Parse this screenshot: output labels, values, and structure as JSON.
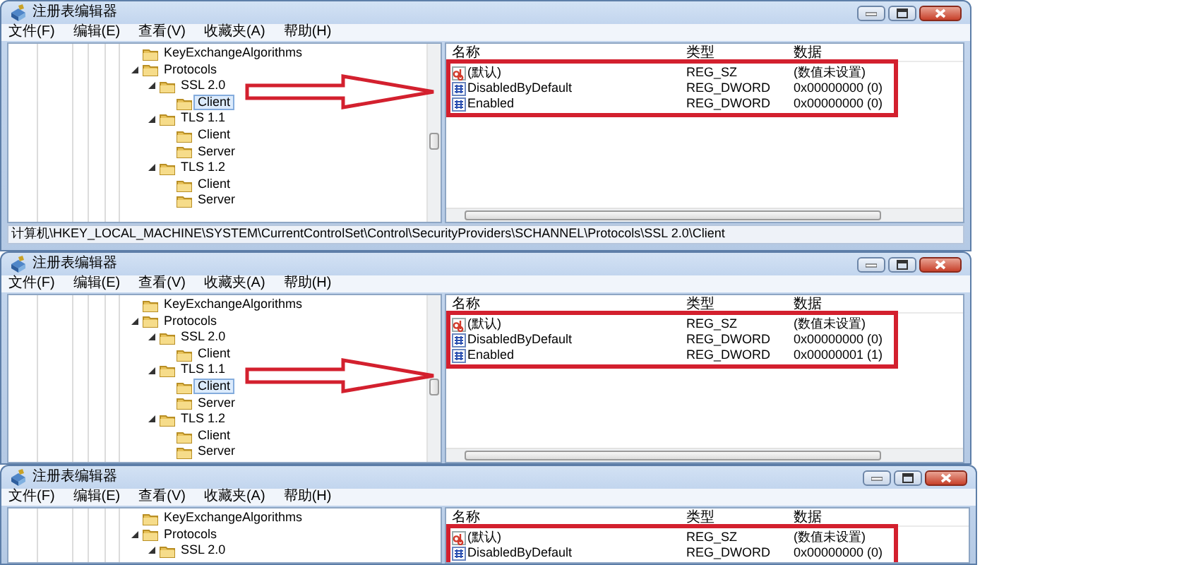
{
  "windows": [
    {
      "title": "注册表编辑器",
      "menu": [
        "文件(F)",
        "编辑(E)",
        "查看(V)",
        "收藏夹(A)",
        "帮助(H)"
      ],
      "tree": [
        {
          "label": "KeyExchangeAlgorithms",
          "selected": false
        },
        {
          "label": "Protocols",
          "selected": false,
          "expanded": true,
          "children": [
            {
              "label": "SSL 2.0",
              "selected": false,
              "expanded": true,
              "children": [
                {
                  "label": "Client",
                  "selected": true
                }
              ]
            },
            {
              "label": "TLS 1.1",
              "selected": false,
              "expanded": true,
              "children": [
                {
                  "label": "Client",
                  "selected": false
                },
                {
                  "label": "Server",
                  "selected": false
                }
              ]
            },
            {
              "label": "TLS 1.2",
              "selected": false,
              "expanded": true,
              "children": [
                {
                  "label": "Client",
                  "selected": false
                },
                {
                  "label": "Server",
                  "selected": false
                }
              ]
            }
          ]
        }
      ],
      "columns": [
        "名称",
        "类型",
        "数据"
      ],
      "rows": [
        {
          "kind": "string",
          "name": "(默认)",
          "type": "REG_SZ",
          "data": "(数值未设置)"
        },
        {
          "kind": "dword",
          "name": "DisabledByDefault",
          "type": "REG_DWORD",
          "data": "0x00000000 (0)"
        },
        {
          "kind": "dword",
          "name": "Enabled",
          "type": "REG_DWORD",
          "data": "0x00000000 (0)"
        }
      ],
      "status": "计算机\\HKEY_LOCAL_MACHINE\\SYSTEM\\CurrentControlSet\\Control\\SecurityProviders\\SCHANNEL\\Protocols\\SSL 2.0\\Client",
      "highlight": true,
      "arrow": true
    },
    {
      "title": "注册表编辑器",
      "menu": [
        "文件(F)",
        "编辑(E)",
        "查看(V)",
        "收藏夹(A)",
        "帮助(H)"
      ],
      "tree": [
        {
          "label": "KeyExchangeAlgorithms",
          "selected": false
        },
        {
          "label": "Protocols",
          "selected": false,
          "expanded": true,
          "children": [
            {
              "label": "SSL 2.0",
              "selected": false,
              "expanded": true,
              "children": [
                {
                  "label": "Client",
                  "selected": false
                }
              ]
            },
            {
              "label": "TLS 1.1",
              "selected": false,
              "expanded": true,
              "children": [
                {
                  "label": "Client",
                  "selected": true
                },
                {
                  "label": "Server",
                  "selected": false
                }
              ]
            },
            {
              "label": "TLS 1.2",
              "selected": false,
              "expanded": true,
              "children": [
                {
                  "label": "Client",
                  "selected": false
                },
                {
                  "label": "Server",
                  "selected": false
                }
              ]
            }
          ]
        }
      ],
      "columns": [
        "名称",
        "类型",
        "数据"
      ],
      "rows": [
        {
          "kind": "string",
          "name": "(默认)",
          "type": "REG_SZ",
          "data": "(数值未设置)"
        },
        {
          "kind": "dword",
          "name": "DisabledByDefault",
          "type": "REG_DWORD",
          "data": "0x00000000 (0)"
        },
        {
          "kind": "dword",
          "name": "Enabled",
          "type": "REG_DWORD",
          "data": "0x00000001 (1)"
        }
      ],
      "highlight": true,
      "arrow": true
    },
    {
      "title": "注册表编辑器",
      "menu": [
        "文件(F)",
        "编辑(E)",
        "查看(V)",
        "收藏夹(A)",
        "帮助(H)"
      ],
      "tree": [
        {
          "label": "KeyExchangeAlgorithms",
          "selected": false
        },
        {
          "label": "Protocols",
          "selected": false,
          "expanded": true,
          "children": [
            {
              "label": "SSL 2.0",
              "selected": false,
              "expanded": true
            }
          ]
        }
      ],
      "columns": [
        "名称",
        "类型",
        "数据"
      ],
      "rows": [
        {
          "kind": "string",
          "name": "(默认)",
          "type": "REG_SZ",
          "data": "(数值未设置)"
        },
        {
          "kind": "dword",
          "name": "DisabledByDefault",
          "type": "REG_DWORD",
          "data": "0x00000000 (0)"
        }
      ],
      "highlight": true,
      "arrow": false
    }
  ]
}
